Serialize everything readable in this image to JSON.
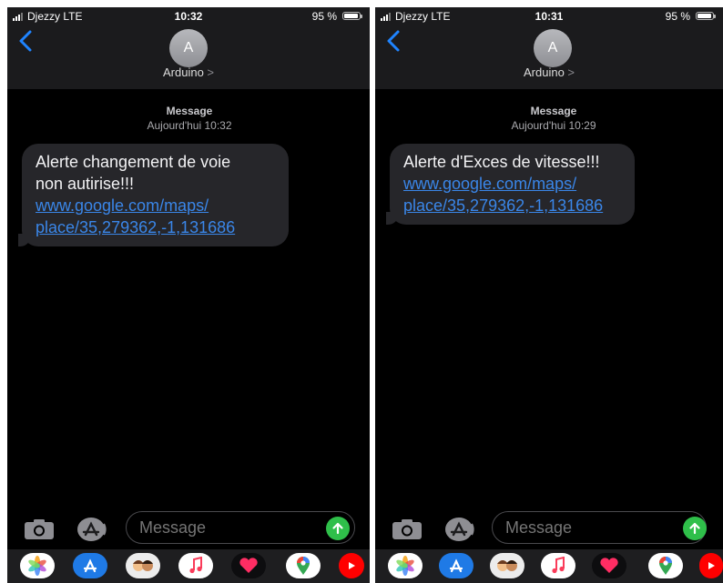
{
  "phones": [
    {
      "status": {
        "carrier": "Djezzy  LTE",
        "time": "10:32",
        "battery": "95 %",
        "battery_level": 0.95
      },
      "contact": {
        "initial": "A",
        "name": "Arduino",
        "chevron": ">"
      },
      "meta": {
        "label": "Message",
        "date": "Aujourd'hui 10:32"
      },
      "message": {
        "line1": "Alerte changement de voie",
        "line2": "non autirise!!!",
        "link1": "www.google.com/maps/",
        "link2": "place/35,279362,-1,131686"
      },
      "compose": {
        "placeholder": "Message"
      }
    },
    {
      "status": {
        "carrier": "Djezzy  LTE",
        "time": "10:31",
        "battery": "95 %",
        "battery_level": 0.95
      },
      "contact": {
        "initial": "A",
        "name": "Arduino",
        "chevron": ">"
      },
      "meta": {
        "label": "Message",
        "date": "Aujourd'hui 10:29"
      },
      "message": {
        "line1": "Alerte d'Exces de vitesse!!!",
        "link1": "www.google.com/maps/",
        "link2": "place/35,279362,-1,131686"
      },
      "compose": {
        "placeholder": "Message"
      }
    }
  ],
  "app_strip": [
    "photos-icon",
    "appstore-icon",
    "memoji-icon",
    "music-icon",
    "digital-touch-icon",
    "maps-icon",
    "youtube-icon"
  ],
  "colors": {
    "link": "#3a86e8",
    "send": "#2fbf4a",
    "bubble": "#26262a",
    "header": "#1b1b1d"
  }
}
